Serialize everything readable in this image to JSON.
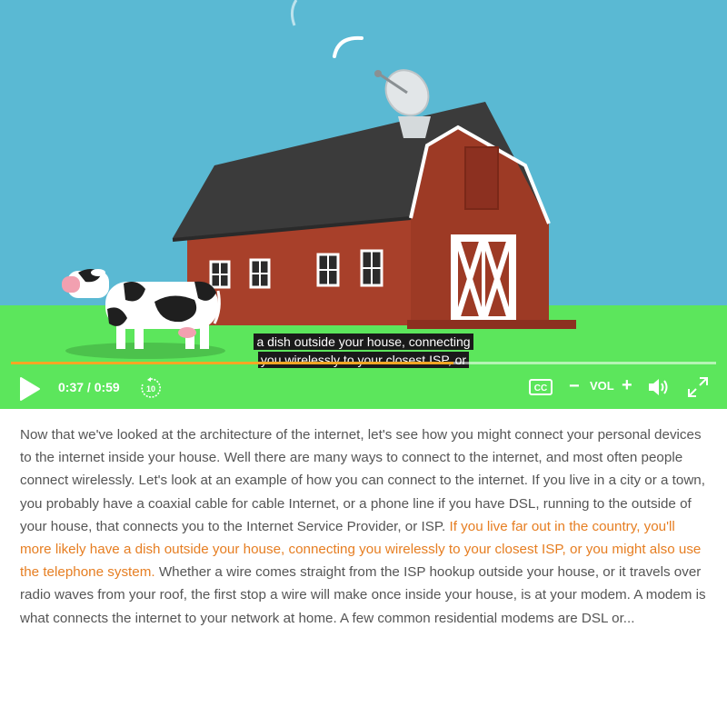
{
  "video": {
    "captions": [
      "a dish outside your house, connecting",
      "you wirelessly to your closest ISP, or"
    ],
    "progress_fraction": 0.627,
    "colors": {
      "sky": "#5ab9d3",
      "grass": "#5ce65c",
      "progress": "#f5a623",
      "barn": "#a8402a",
      "roof": "#3b3b3b"
    }
  },
  "controls": {
    "play_icon": "play-icon",
    "time_display": "0:37 / 0:59",
    "rewind_label": "10",
    "cc_label": "CC",
    "vol_minus": "−",
    "vol_label": "VOL",
    "vol_plus": "+",
    "speaker_icon": "speaker-icon",
    "fullscreen_icon": "fullscreen-icon"
  },
  "transcript": {
    "before": "Now that we've looked at the architecture of the internet, let's see how you might connect your personal devices to the internet inside your house. Well there are many ways to connect to the internet, and most often people connect wirelessly. Let's look at an example of how you can connect to the internet. If you live in a city or a town, you probably have a coaxial cable for cable Internet, or a phone line if you have DSL, running to the outside of your house, that connects you to the Internet Service Provider, or ISP. ",
    "highlight": "If you live far out in the country, you'll more likely have a dish outside your house, connecting you wirelessly to your closest ISP, or you might also use the telephone system.",
    "after": " Whether a wire comes straight from the ISP hookup outside your house, or it travels over radio waves from your roof, the first stop a wire will make once inside your house, is at your modem. A modem is what connects the internet to your network at home. A few common residential modems are DSL or..."
  }
}
